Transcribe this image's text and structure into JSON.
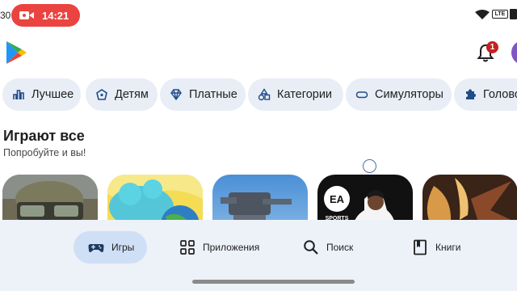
{
  "status_bar": {
    "clock_partial": "30",
    "recording_time": "14:21",
    "network_badge": "LTE",
    "recording_color": "#ea4340"
  },
  "header": {
    "logo_icon": "google-play-logo",
    "notifications_count": "1",
    "badge_color": "#c5221f"
  },
  "chips": [
    {
      "label": "Лучшее",
      "icon": "bar-chart-icon"
    },
    {
      "label": "Детям",
      "icon": "kids-shield-icon"
    },
    {
      "label": "Платные",
      "icon": "diamond-icon"
    },
    {
      "label": "Категории",
      "icon": "shapes-icon"
    },
    {
      "label": "Симуляторы",
      "icon": "gamepad-icon"
    },
    {
      "label": "Голово",
      "icon": "puzzle-icon"
    }
  ],
  "section": {
    "title": "Играют все",
    "subtitle": "Попробуйте и вы!"
  },
  "cards": [
    {
      "name": "card-soldier-game",
      "ea_label": "",
      "sports_label": ""
    },
    {
      "name": "card-toca-game",
      "ea_label": "",
      "sports_label": ""
    },
    {
      "name": "card-robots-game",
      "ea_label": "",
      "sports_label": ""
    },
    {
      "name": "card-ea-sports-fc",
      "ea_label": "EA",
      "sports_label": "SPORTS"
    },
    {
      "name": "card-fantasy-game",
      "ea_label": "",
      "sports_label": ""
    }
  ],
  "bottom_nav": {
    "items": [
      {
        "label": "Игры",
        "icon": "gamepad-icon",
        "selected": true
      },
      {
        "label": "Приложения",
        "icon": "apps-grid-icon",
        "selected": false
      },
      {
        "label": "Поиск",
        "icon": "search-icon",
        "selected": false
      },
      {
        "label": "Книги",
        "icon": "book-icon",
        "selected": false
      }
    ],
    "accent": "#cfdff5"
  }
}
